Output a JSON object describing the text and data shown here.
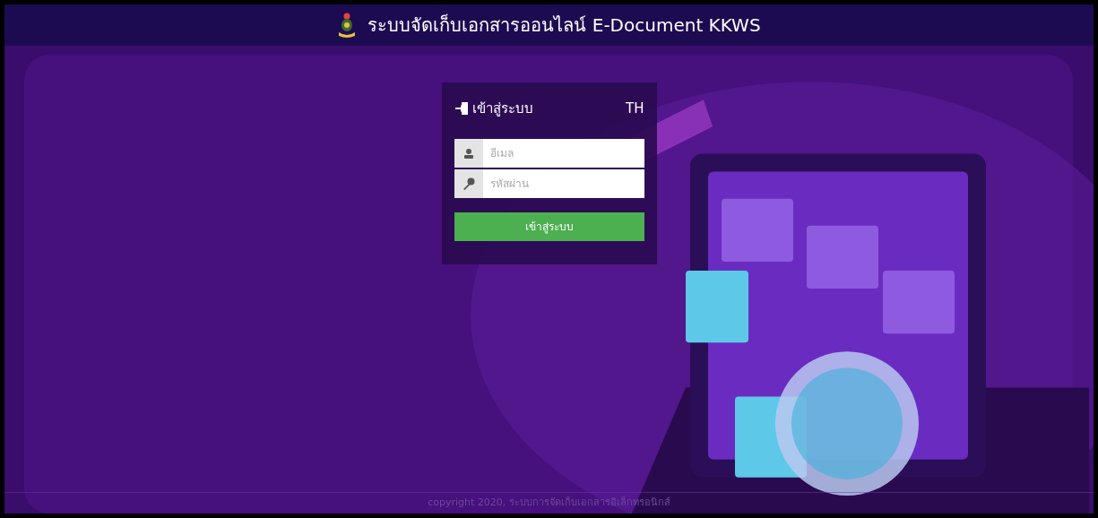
{
  "header": {
    "title": "ระบบจัดเก็บเอกสารออนไลน์ E-Document KKWS"
  },
  "login": {
    "title": "เข้าสู่ระบบ",
    "language": "TH",
    "fields": [
      {
        "kind": "email",
        "placeholder": "อีเมล"
      },
      {
        "kind": "password",
        "placeholder": "รหัสผ่าน"
      }
    ],
    "submit": "เข้าสู่ระบบ"
  },
  "footer": {
    "copyright": "copyright 2020, ระบบการจัดเก็บเอกสารอิเล็กทรอนิกส์"
  }
}
